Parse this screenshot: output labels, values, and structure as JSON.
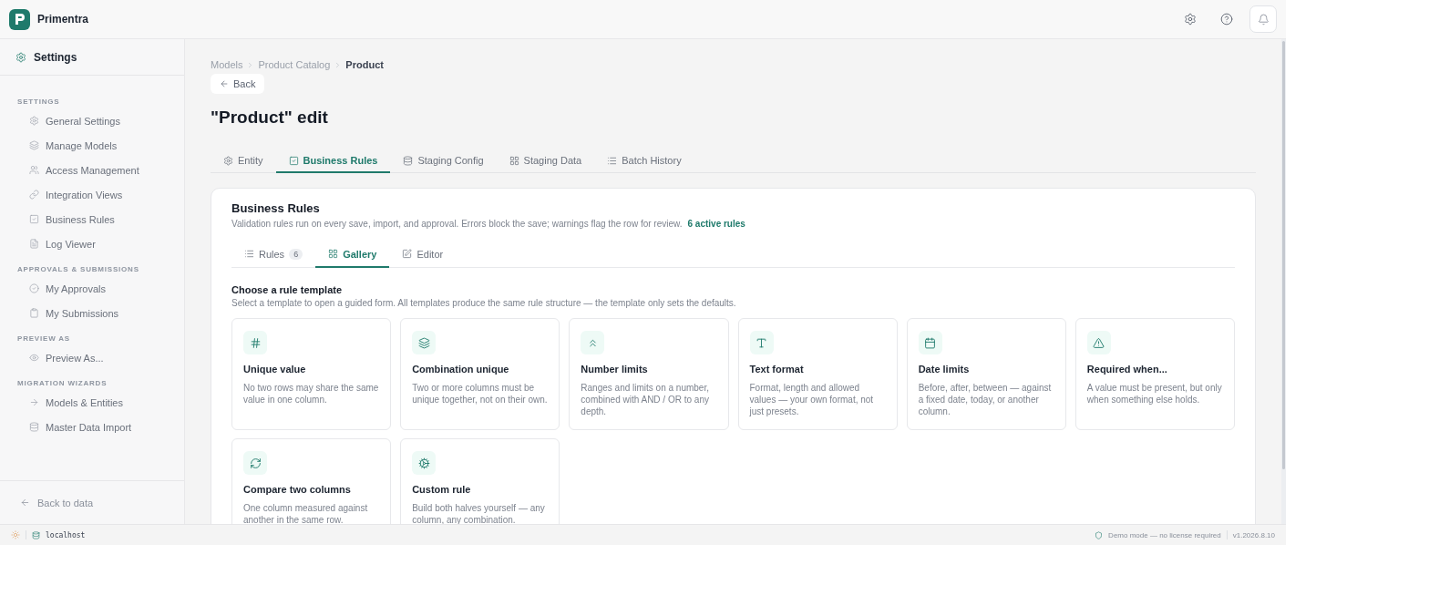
{
  "app": {
    "name": "Primentra"
  },
  "sidebar": {
    "title": "Settings",
    "groups": [
      {
        "label": "SETTINGS",
        "items": [
          "General Settings",
          "Manage Models",
          "Access Management",
          "Integration Views",
          "Business Rules",
          "Log Viewer"
        ]
      },
      {
        "label": "APPROVALS & SUBMISSIONS",
        "items": [
          "My Approvals",
          "My Submissions"
        ]
      },
      {
        "label": "PREVIEW AS",
        "items": [
          "Preview As..."
        ]
      },
      {
        "label": "MIGRATION WIZARDS",
        "items": [
          "Models & Entities",
          "Master Data Import"
        ]
      }
    ],
    "back_link": "Back to data"
  },
  "breadcrumbs": [
    "Models",
    "Product Catalog",
    "Product"
  ],
  "back_button": "Back",
  "page_title": "\"Product\" edit",
  "tabs": [
    {
      "label": "Entity",
      "selected": false
    },
    {
      "label": "Business Rules",
      "selected": true
    },
    {
      "label": "Staging Config",
      "selected": false
    },
    {
      "label": "Staging Data",
      "selected": false
    },
    {
      "label": "Batch History",
      "selected": false
    }
  ],
  "panel": {
    "title": "Business Rules",
    "description": "Validation rules run on every save, import, and approval. Errors block the save; warnings flag the row for review.",
    "active_count": "6 active rules",
    "subtabs": [
      {
        "label": "Rules",
        "badge": "6",
        "selected": false
      },
      {
        "label": "Gallery",
        "selected": true
      },
      {
        "label": "Editor",
        "selected": false
      }
    ],
    "section_title": "Choose a rule template",
    "section_description": "Select a template to open a guided form. All templates produce the same rule structure — the template only sets the defaults.",
    "templates": [
      {
        "title": "Unique value",
        "description": "No two rows may share the same value in one column."
      },
      {
        "title": "Combination unique",
        "description": "Two or more columns must be unique together, not on their own."
      },
      {
        "title": "Number limits",
        "description": "Ranges and limits on a number, combined with AND / OR to any depth."
      },
      {
        "title": "Text format",
        "description": "Format, length and allowed values — your own format, not just presets."
      },
      {
        "title": "Date limits",
        "description": "Before, after, between — against a fixed date, today, or another column."
      },
      {
        "title": "Required when...",
        "description": "A value must be present, but only when something else holds."
      },
      {
        "title": "Compare two columns",
        "description": "One column measured against another in the same row."
      },
      {
        "title": "Custom rule",
        "description": "Build both halves yourself — any column, any combination."
      }
    ]
  },
  "status_bar": {
    "host": "localhost",
    "mode": "Demo mode — no license required",
    "version": "v1.2026.8.10"
  }
}
